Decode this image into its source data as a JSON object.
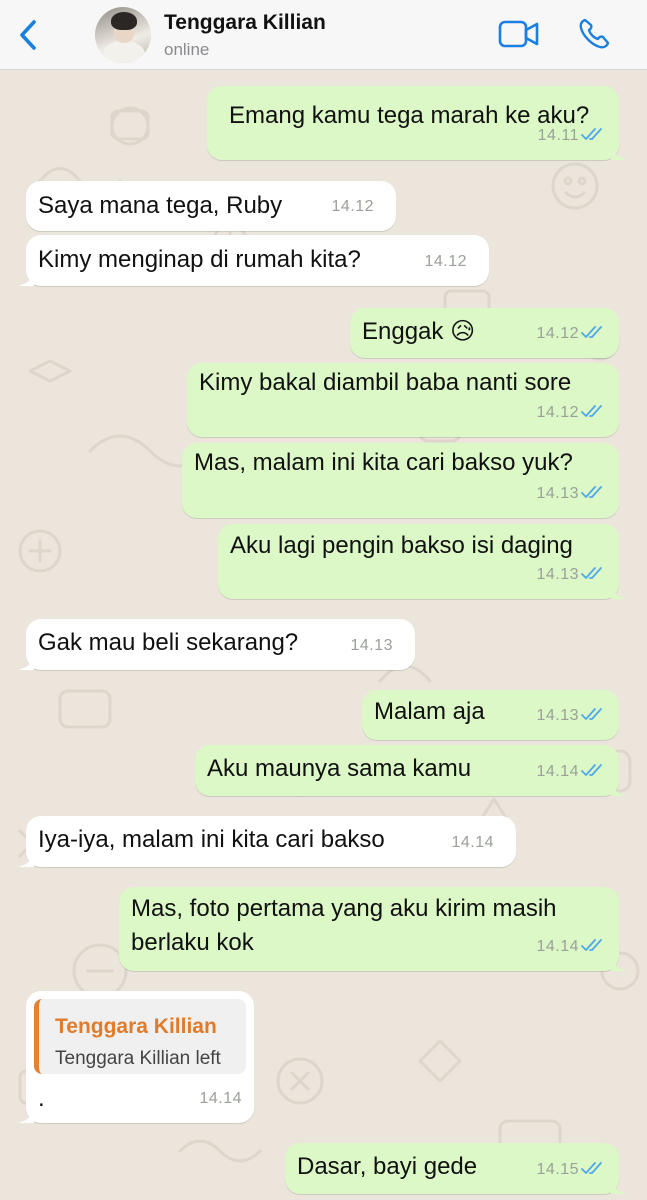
{
  "header": {
    "contact_name": "Tenggara Killian",
    "status": "online",
    "back_icon": "chevron-left-icon",
    "video_icon": "video-camera-icon",
    "call_icon": "phone-icon",
    "accent": "#1a7fe0"
  },
  "messages": [
    {
      "dir": "out",
      "text": "Emang kamu tega marah ke aku?",
      "time": "14.11",
      "read": true
    },
    {
      "dir": "in",
      "text": "Saya mana tega, Ruby",
      "time": "14.12"
    },
    {
      "dir": "in",
      "text": "Kimy menginap di rumah kita?",
      "time": "14.12"
    },
    {
      "dir": "out",
      "text": "Enggak 😥",
      "time": "14.12",
      "read": true
    },
    {
      "dir": "out",
      "text": "Kimy bakal diambil baba nanti sore",
      "time": "14.12",
      "read": true
    },
    {
      "dir": "out",
      "text": "Mas, malam ini kita cari bakso yuk?",
      "time": "14.13",
      "read": true
    },
    {
      "dir": "out",
      "text": "Aku lagi pengin bakso isi daging",
      "time": "14.13",
      "read": true
    },
    {
      "dir": "in",
      "text": "Gak mau beli sekarang?",
      "time": "14.13"
    },
    {
      "dir": "out",
      "text": "Malam aja",
      "time": "14.13",
      "read": true
    },
    {
      "dir": "out",
      "text": "Aku maunya sama kamu",
      "time": "14.14",
      "read": true
    },
    {
      "dir": "in",
      "text": "Iya-iya, malam ini kita cari bakso",
      "time": "14.14"
    },
    {
      "dir": "out",
      "text_line1": "Mas, foto pertama yang aku kirim masih",
      "text_line2": "berlaku kok",
      "time": "14.14",
      "read": true
    },
    {
      "dir": "in",
      "quote_name": "Tenggara Killian",
      "quote_text": "Tenggara Killian left",
      "text": ".",
      "time": "14.14"
    },
    {
      "dir": "out",
      "text": "Dasar, bayi gede",
      "time": "14.15",
      "read": true
    }
  ],
  "colors": {
    "outgoing_bubble": "#dcf8c6",
    "incoming_bubble": "#ffffff",
    "read_ticks": "#4fa8e8",
    "quote_accent": "#e6812d",
    "wallpaper": "#ebe5dc"
  }
}
